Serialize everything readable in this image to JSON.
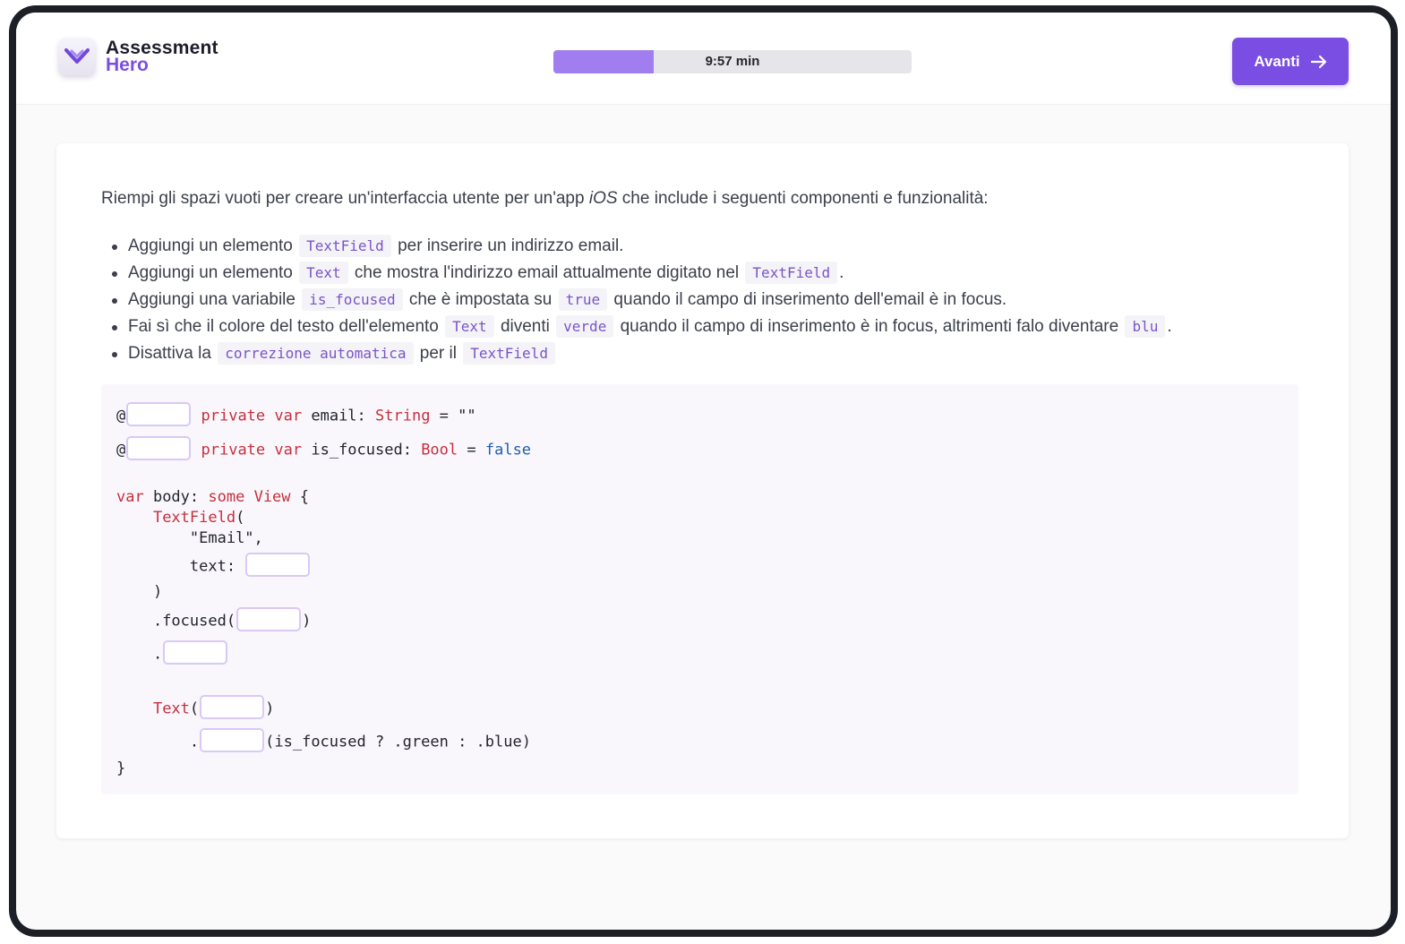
{
  "header": {
    "brand_line1": "Assessment",
    "brand_line2": "Hero",
    "timer": "9:57 min",
    "progress_fraction": 0.28,
    "next_label": "Avanti"
  },
  "question": {
    "intro_before": "Riempi gli spazi vuoti per creare un'interfaccia utente per un'app ",
    "intro_em": "iOS",
    "intro_after": " che include i seguenti componenti e funzionalità:",
    "bullets": [
      {
        "p1": "Aggiungi un elemento ",
        "c1": "TextField",
        "p2": " per inserire un indirizzo email."
      },
      {
        "p1": "Aggiungi un elemento ",
        "c1": "Text",
        "p2": " che mostra l'indirizzo email attualmente digitato nel ",
        "c2": "TextField",
        "p3": "."
      },
      {
        "p1": "Aggiungi una variabile ",
        "c1": "is_focused",
        "p2": " che è impostata su ",
        "c2": "true",
        "p3": " quando il campo di inserimento dell'email è in focus."
      },
      {
        "p1": "Fai sì che il colore del testo dell'elemento ",
        "c1": "Text",
        "p2": " diventi ",
        "c2": "verde",
        "p3": " quando il campo di inserimento è in focus, altrimenti falo diventare ",
        "c3": "blu",
        "p4": "."
      },
      {
        "p1": "Disattiva la ",
        "c1": "correzione automatica",
        "p2": " per il ",
        "c2": "TextField"
      }
    ]
  },
  "code": {
    "at": "@",
    "private": "private",
    "var": "var",
    "email_decl": " email: ",
    "string_type": "String",
    "assign_empty": " = \"\"",
    "focused_decl": " is_focused: ",
    "bool_type": "Bool",
    "eq": " = ",
    "false_val": "false",
    "body_decl": " body: ",
    "some": "some",
    "view": "View",
    "open_brace": " {",
    "textfield_call": "TextField",
    "open_paren": "(",
    "email_str": "\"Email\",",
    "text_label": "text:",
    "close_paren": ")",
    "focused_mod": ".focused(",
    "dot": ".",
    "text_call": "Text",
    "ternary": "(is_focused ? .green : .blue)",
    "close_brace": "}"
  }
}
